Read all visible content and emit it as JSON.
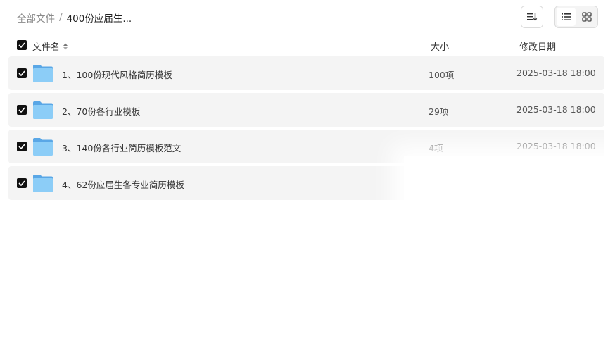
{
  "breadcrumb": {
    "root": "全部文件",
    "separator": "/",
    "current": "400份应届生..."
  },
  "toolbar": {
    "sort_icon": "sort-icon",
    "list_view_icon": "list-view-icon",
    "grid_view_icon": "grid-view-icon"
  },
  "header": {
    "name": "文件名",
    "size": "大小",
    "date": "修改日期"
  },
  "rows": [
    {
      "name": "1、100份现代风格简历模板",
      "size": "100项",
      "date": "2025-03-18 18:00"
    },
    {
      "name": "2、70份各行业模板",
      "size": "29项",
      "date": "2025-03-18 18:00"
    },
    {
      "name": "3、140份各行业简历模板范文",
      "size": "4项",
      "date": "2025-03-18 18:00"
    },
    {
      "name": "4、62份应届生各专业简历模板",
      "size": "",
      "date": ""
    }
  ],
  "colors": {
    "row_bg": "#f4f4f4",
    "checkbox": "#111111",
    "folder": "#7cc3f5"
  }
}
